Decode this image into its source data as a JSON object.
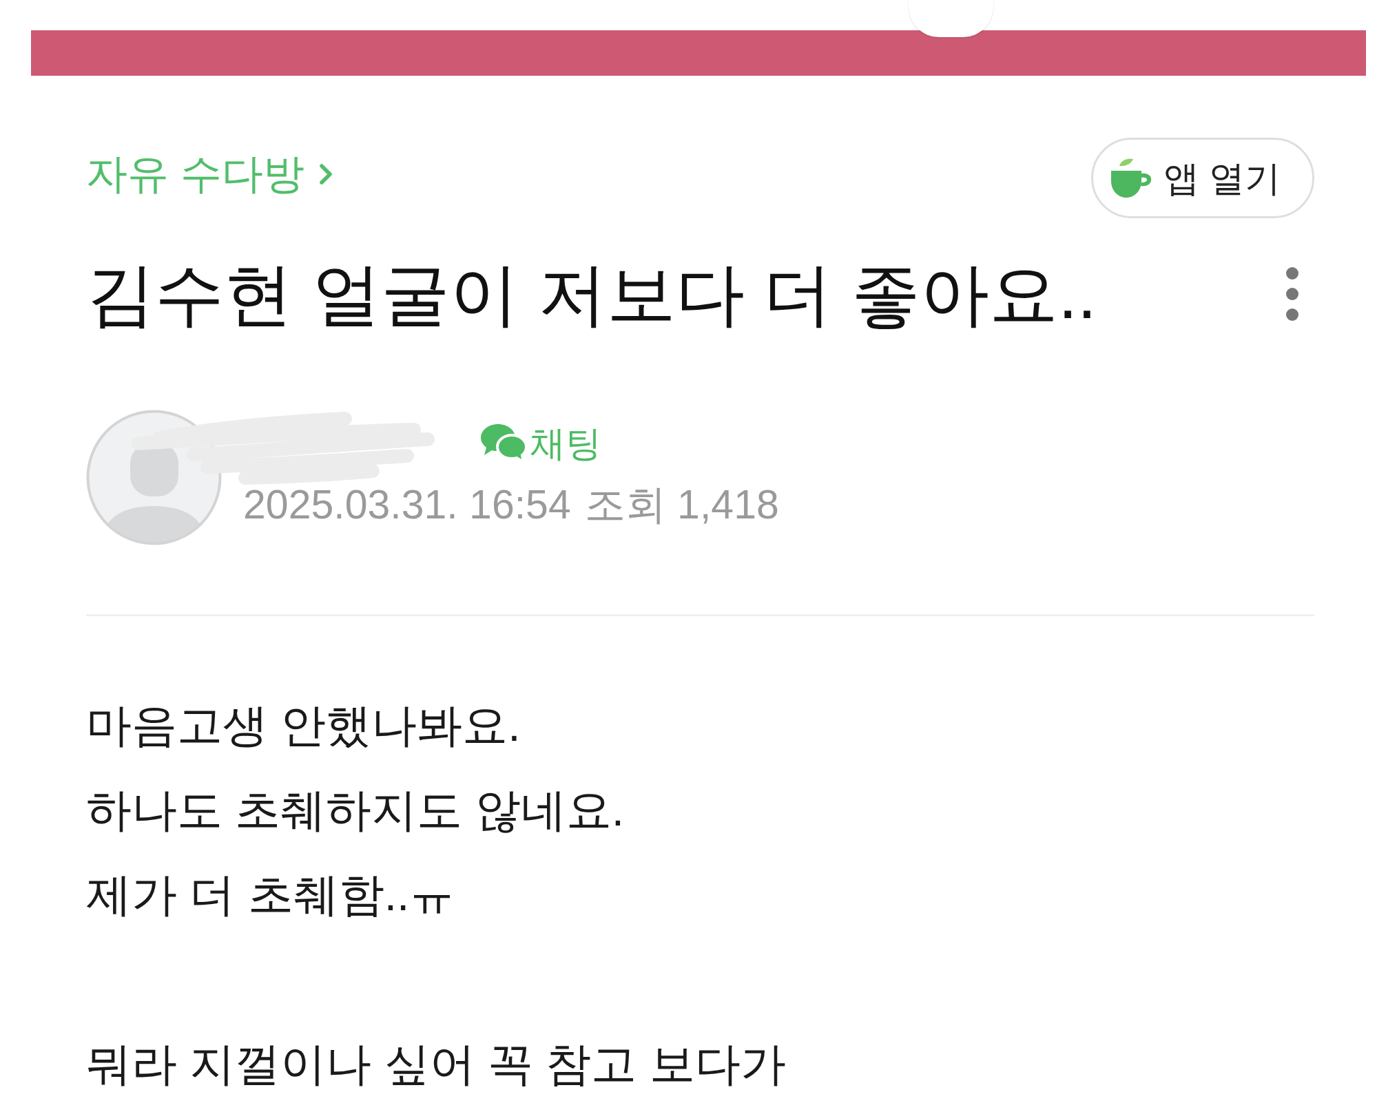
{
  "header": {
    "breadcrumb": "자유 수다방",
    "open_app_button": "앱 열기"
  },
  "post": {
    "title": "김수현 얼굴이 저보다 더 좋아요..",
    "author": {
      "chat_button": "채팅",
      "date": "2025.03.31. 16:54",
      "views": "조회 1,418"
    }
  },
  "body": {
    "paragraphs": [
      [
        "마음고생 안했나봐요.",
        "하나도 초췌하지도 않네요.",
        "제가 더 초췌함..ㅠ"
      ],
      [
        "뭐라 지껄이나 싶어 꼭 참고 보다가"
      ]
    ]
  }
}
